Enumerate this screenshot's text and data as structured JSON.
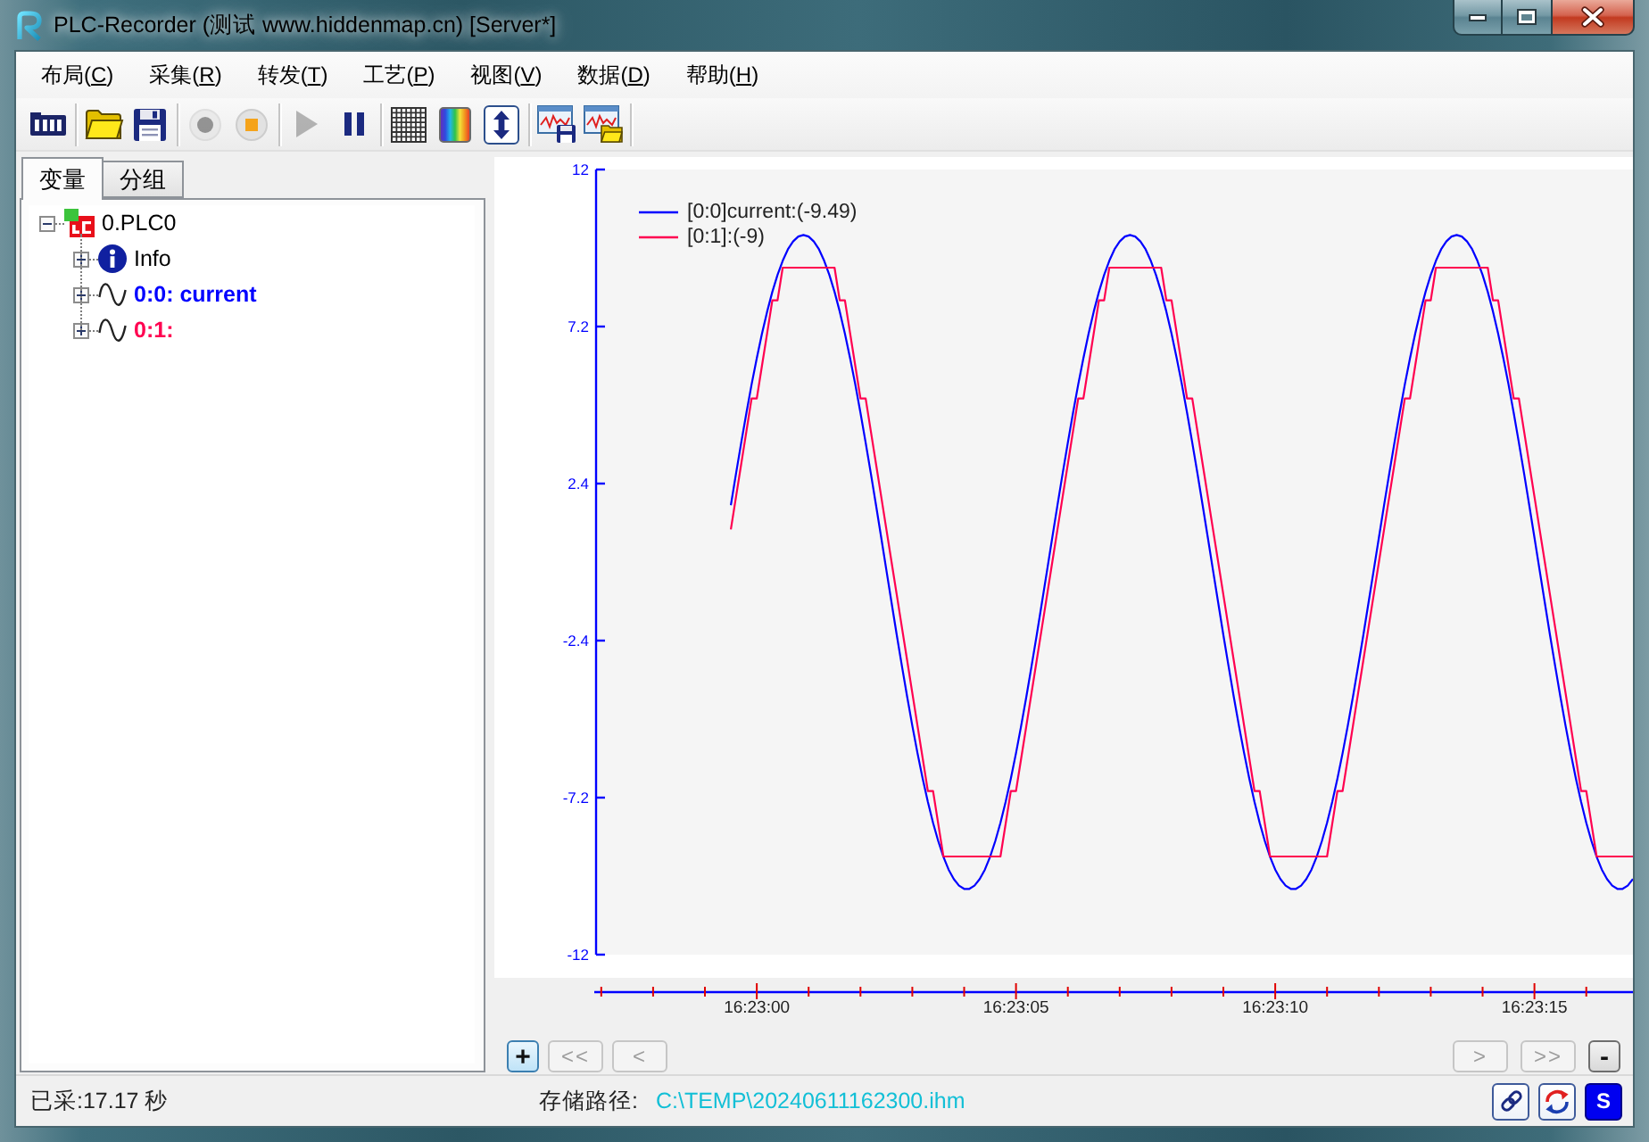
{
  "window": {
    "title": "PLC-Recorder (测试 www.hiddenmap.cn) [Server*]"
  },
  "menu": [
    "布局(C)",
    "采集(R)",
    "转发(T)",
    "工艺(P)",
    "视图(V)",
    "数据(D)",
    "帮助(H)"
  ],
  "toolbar": [
    {
      "kind": "module",
      "disabled": false
    },
    {
      "kind": "separator"
    },
    {
      "kind": "open",
      "disabled": false
    },
    {
      "kind": "save",
      "disabled": false
    },
    {
      "kind": "separator"
    },
    {
      "kind": "record",
      "disabled": true
    },
    {
      "kind": "stop",
      "disabled": false
    },
    {
      "kind": "separator"
    },
    {
      "kind": "play",
      "disabled": true
    },
    {
      "kind": "pause",
      "disabled": false
    },
    {
      "kind": "separator"
    },
    {
      "kind": "grid",
      "disabled": false
    },
    {
      "kind": "colors",
      "disabled": false
    },
    {
      "kind": "autoscale",
      "disabled": false
    },
    {
      "kind": "separator"
    },
    {
      "kind": "chart_save",
      "disabled": false
    },
    {
      "kind": "chart_open",
      "disabled": false
    },
    {
      "kind": "separator"
    }
  ],
  "tabs": [
    {
      "label": "变量",
      "selected": true
    },
    {
      "label": "分组",
      "selected": false
    }
  ],
  "tree": [
    {
      "label": "0.PLC0",
      "kind": "plc",
      "expanded": true,
      "children": [
        {
          "label": "Info",
          "kind": "info",
          "expanded": false
        },
        {
          "label": "0:0: current",
          "kind": "signal",
          "color": "#0000ff",
          "expanded": false
        },
        {
          "label": "0:1:",
          "kind": "signal",
          "color": "#ff0050",
          "expanded": false
        }
      ]
    }
  ],
  "chart": {
    "chart_data": {
      "type": "line",
      "legend": "upper left",
      "categories": [
        null,
        null,
        null,
        null,
        null,
        null,
        null,
        null,
        null,
        null,
        null,
        null,
        null,
        null,
        null,
        null,
        null,
        null,
        null,
        null,
        null,
        null,
        null,
        null,
        null,
        null,
        null,
        null,
        null,
        null,
        null,
        "16:23:00",
        null,
        null,
        null,
        null,
        null,
        null,
        null,
        null,
        null,
        null,
        null,
        null,
        null,
        null,
        null,
        null,
        null,
        null,
        null,
        null,
        null,
        null,
        null,
        null,
        null,
        null,
        null,
        null,
        null,
        null,
        null,
        null,
        null,
        null,
        null,
        null,
        null,
        null,
        null,
        null,
        null,
        null,
        null,
        null,
        null,
        null,
        null,
        null,
        null,
        "16:23:05",
        null,
        null,
        null,
        null,
        null,
        null,
        null,
        null,
        null,
        null,
        null,
        null,
        null,
        null,
        null,
        null,
        null,
        null,
        null,
        null,
        null,
        null,
        null,
        null,
        null,
        null,
        null,
        null,
        null,
        null,
        null,
        null,
        null,
        null,
        null,
        null,
        null,
        null,
        null,
        null,
        null,
        null,
        null,
        null,
        null,
        null,
        null,
        null,
        null,
        "16:23:10",
        null,
        null,
        null,
        null,
        null,
        null,
        null,
        null,
        null,
        null,
        null,
        null,
        null,
        null,
        null,
        null,
        null,
        null,
        null,
        null,
        null,
        null,
        null,
        null,
        null,
        null,
        null,
        null,
        null,
        null,
        null,
        null,
        null,
        null,
        null,
        null,
        null,
        null,
        null,
        null,
        null,
        null,
        null,
        null,
        null,
        null,
        null,
        null,
        null,
        "16:23:15",
        null,
        null,
        null,
        null,
        null,
        null,
        null,
        null,
        null,
        null,
        null,
        null,
        null,
        null,
        null,
        null,
        null,
        null,
        null
      ],
      "series": [
        {
          "name": "[0:0]current:(-9.49)",
          "color": "#0000ff",
          "values": [
            null,
            null,
            null,
            null,
            null,
            null,
            null,
            null,
            null,
            null,
            null,
            null,
            null,
            null,
            null,
            null,
            null,
            null,
            null,
            null,
            null,
            null,
            null,
            null,
            null,
            null,
            1.74,
            2.71,
            3.65,
            4.56,
            5.43,
            6.23,
            6.98,
            7.66,
            8.26,
            8.78,
            9.21,
            9.56,
            9.8,
            9.95,
            10,
            9.95,
            9.8,
            9.56,
            9.21,
            8.78,
            8.26,
            7.66,
            6.98,
            6.23,
            5.43,
            4.56,
            3.65,
            2.71,
            1.74,
            0.75,
            -0.25,
            -1.24,
            -2.23,
            -3.18,
            -4.11,
            -5,
            -5.84,
            -6.62,
            -7.33,
            -7.97,
            -8.53,
            -9.01,
            -9.4,
            -9.69,
            -9.89,
            -9.99,
            -9.99,
            -9.89,
            -9.69,
            -9.4,
            -9.01,
            -8.53,
            -7.97,
            -7.33,
            -6.62,
            -5.84,
            -5,
            -4.11,
            -3.18,
            -2.23,
            -1.24,
            -0.25,
            0.75,
            1.74,
            2.71,
            3.65,
            4.56,
            5.43,
            6.23,
            6.98,
            7.66,
            8.26,
            8.78,
            9.21,
            9.56,
            9.8,
            9.95,
            10,
            9.95,
            9.8,
            9.56,
            9.21,
            8.78,
            8.26,
            7.66,
            6.98,
            6.23,
            5.43,
            4.56,
            3.65,
            2.71,
            1.74,
            0.75,
            -0.25,
            -1.24,
            -2.23,
            -3.18,
            -4.11,
            -5,
            -5.84,
            -6.62,
            -7.33,
            -7.97,
            -8.53,
            -9.01,
            -9.4,
            -9.69,
            -9.89,
            -9.99,
            -9.99,
            -9.89,
            -9.69,
            -9.4,
            -9.01,
            -8.53,
            -7.97,
            -7.33,
            -6.62,
            -5.84,
            -5,
            -4.11,
            -3.18,
            -2.23,
            -1.24,
            -0.25,
            0.75,
            1.74,
            2.71,
            3.65,
            4.56,
            5.43,
            6.23,
            6.98,
            7.66,
            8.26,
            8.78,
            9.21,
            9.56,
            9.8,
            9.95,
            10,
            9.95,
            9.8,
            9.56,
            9.21,
            8.78,
            8.26,
            7.66,
            6.98,
            6.23,
            5.43,
            4.56,
            3.65,
            2.71,
            1.74,
            0.75,
            -0.25,
            -1.24,
            -2.23,
            -3.18,
            -4.11,
            -5,
            -5.84,
            -6.62,
            -7.33,
            -7.97,
            -8.53,
            -9.01,
            -9.4,
            -9.69,
            -9.89,
            -9.99,
            -9.99,
            -9.89,
            -9.69
          ]
        },
        {
          "name": "[0:1]:(-9)",
          "color": "#ff0050",
          "values": [
            null,
            null,
            null,
            null,
            null,
            null,
            null,
            null,
            null,
            null,
            null,
            null,
            null,
            null,
            null,
            null,
            null,
            null,
            null,
            null,
            null,
            null,
            null,
            null,
            null,
            null,
            1,
            2,
            3,
            4,
            5,
            5,
            6,
            7,
            8,
            8,
            9,
            9,
            9,
            9,
            9,
            9,
            9,
            9,
            9,
            9,
            9,
            8,
            8,
            7,
            6,
            5,
            5,
            4,
            3,
            2,
            1,
            0,
            -1,
            -2,
            -3,
            -4,
            -5,
            -6,
            -7,
            -7,
            -8,
            -9,
            -9,
            -9,
            -9,
            -9,
            -9,
            -9,
            -9,
            -9,
            -9,
            -9,
            -9,
            -8,
            -7,
            -7,
            -6,
            -5,
            -4,
            -3,
            -2,
            -1,
            0,
            1,
            2,
            3,
            4,
            5,
            5,
            6,
            7,
            8,
            8,
            9,
            9,
            9,
            9,
            9,
            9,
            9,
            9,
            9,
            9,
            9,
            8,
            8,
            7,
            6,
            5,
            5,
            4,
            3,
            2,
            1,
            0,
            -1,
            -2,
            -3,
            -4,
            -5,
            -6,
            -7,
            -7,
            -8,
            -9,
            -9,
            -9,
            -9,
            -9,
            -9,
            -9,
            -9,
            -9,
            -9,
            -9,
            -9,
            -8,
            -7,
            -7,
            -6,
            -5,
            -4,
            -3,
            -2,
            -1,
            0,
            1,
            2,
            3,
            4,
            5,
            5,
            6,
            7,
            8,
            8,
            9,
            9,
            9,
            9,
            9,
            9,
            9,
            9,
            9,
            9,
            9,
            8,
            8,
            7,
            6,
            5,
            5,
            4,
            3,
            2,
            1,
            0,
            -1,
            -2,
            -3,
            -4,
            -5,
            -6,
            -7,
            -7,
            -8,
            -9,
            -9,
            -9,
            -9,
            -9,
            -9,
            -9,
            -9
          ]
        }
      ],
      "ylim": [
        -12,
        12
      ],
      "yticks": [
        12,
        7.2,
        2.4,
        -2.4,
        -7.2,
        -12
      ]
    }
  },
  "navigation": {
    "left": [
      {
        "label": "+",
        "disabled": false,
        "focused": true
      },
      {
        "label": "<<",
        "disabled": true,
        "focused": false
      },
      {
        "label": "<",
        "disabled": true,
        "focused": false
      }
    ],
    "right": [
      {
        "label": ">",
        "disabled": true,
        "focused": false
      },
      {
        "label": ">>",
        "disabled": true,
        "focused": false
      },
      {
        "label": "-",
        "disabled": false,
        "focused": false
      }
    ]
  },
  "status_bar": {
    "elapsed": "已采:17.17 秒",
    "path_label": "存储路径:",
    "path": "C:\\TEMP\\20240611162300.ihm",
    "buttons": [
      {
        "kind": "link"
      },
      {
        "kind": "sync"
      },
      {
        "kind": "server",
        "label": "S"
      }
    ]
  }
}
